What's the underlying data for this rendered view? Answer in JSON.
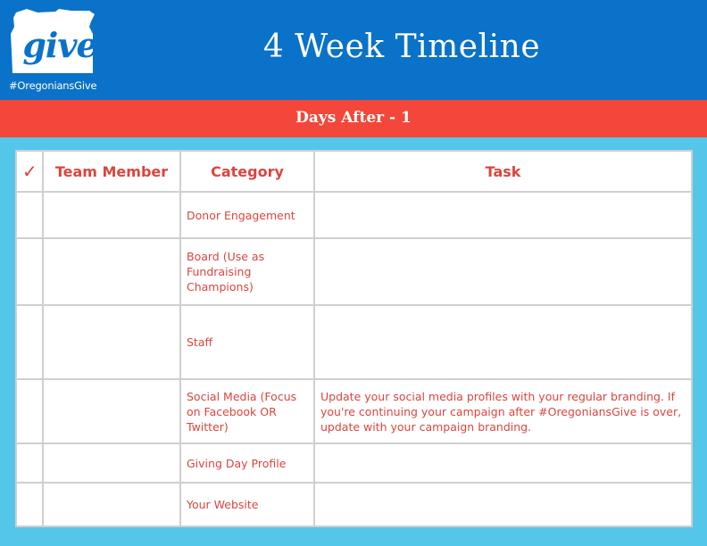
{
  "header": {
    "logo_text": "give",
    "hashtag": "#OregoniansGive",
    "title": "4 Week Timeline",
    "background_color": "#0a72c8"
  },
  "section": {
    "title": "Days After - 1",
    "background_color": "#f2473a"
  },
  "table": {
    "columns": {
      "check_icon": "checkmark-icon",
      "check_symbol": "✓",
      "team_member": "Team Member",
      "category": "Category",
      "task": "Task"
    },
    "rows": [
      {
        "team_member": "",
        "category": "Donor Engagement",
        "task": ""
      },
      {
        "team_member": "",
        "category": "Board (Use as Fundraising Champions)",
        "task": ""
      },
      {
        "team_member": "",
        "category": "Staff",
        "task": ""
      },
      {
        "team_member": "",
        "category": "Social Media (Focus on Facebook OR Twitter)",
        "task": "Update your social media profiles with your regular branding. If you're continuing your campaign after #OregoniansGive is over, update with your campaign branding."
      },
      {
        "team_member": "",
        "category": "Giving Day Profile",
        "task": ""
      },
      {
        "team_member": "",
        "category": "Your Website",
        "task": ""
      }
    ]
  }
}
